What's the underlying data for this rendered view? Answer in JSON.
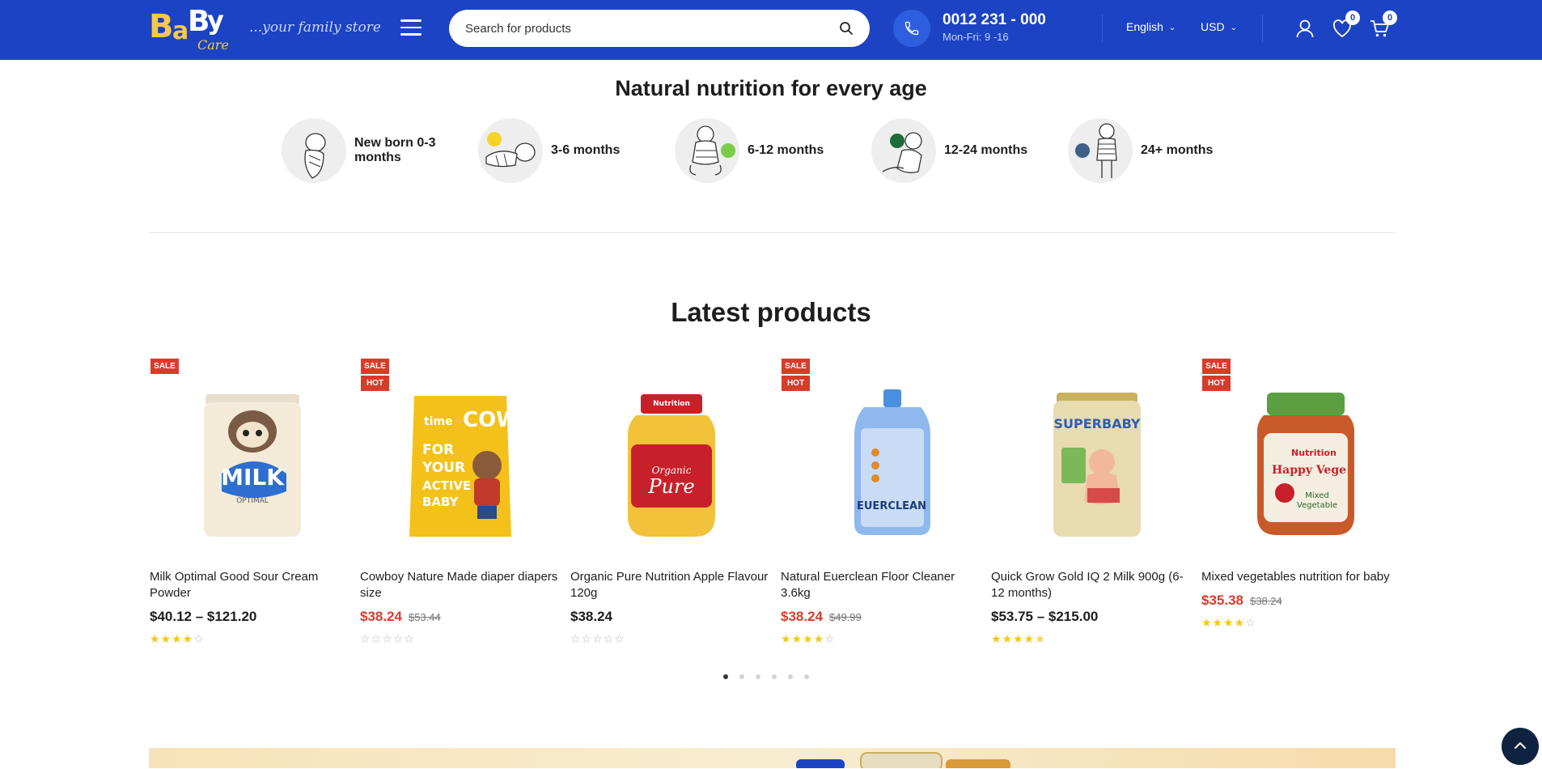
{
  "header": {
    "logo": "BaBy Care",
    "logo_sub": "Care",
    "tagline": "...your family store",
    "search_placeholder": "Search for products",
    "phone": "0012 231 - 000",
    "hours": "Mon-Fri: 9 -16",
    "language": "English",
    "currency": "USD",
    "wishlist_count": "0",
    "cart_count": "0"
  },
  "nutrition": {
    "title": "Natural nutrition for every age",
    "ages": [
      {
        "label": "New born 0-3 months"
      },
      {
        "label": "3-6 months"
      },
      {
        "label": "6-12 months"
      },
      {
        "label": "12-24 months"
      },
      {
        "label": "24+ months"
      }
    ]
  },
  "latest": {
    "title": "Latest products",
    "products": [
      {
        "name": "Milk Optimal Good Sour Cream Powder",
        "price": "$40.12 – $121.20",
        "old_price": "",
        "on_sale": true,
        "hot": false,
        "tags": [
          "SALE"
        ],
        "rating": 4,
        "rating_max": 5
      },
      {
        "name": "Cowboy Nature Made diaper diapers size",
        "price": "$38.24",
        "old_price": "$53.44",
        "on_sale": true,
        "hot": true,
        "tags": [
          "SALE",
          "HOT"
        ],
        "rating": 0,
        "rating_max": 5
      },
      {
        "name": "Organic Pure Nutrition Apple Flavour 120g",
        "price": "$38.24",
        "old_price": "",
        "on_sale": false,
        "hot": false,
        "tags": [],
        "rating": 0,
        "rating_max": 5
      },
      {
        "name": "Natural Euerclean Floor Cleaner 3.6kg",
        "price": "$38.24",
        "old_price": "$49.99",
        "on_sale": true,
        "hot": true,
        "tags": [
          "SALE",
          "HOT"
        ],
        "rating": 4,
        "rating_max": 5
      },
      {
        "name": "Quick Grow Gold IQ 2 Milk 900g (6-12 months)",
        "price": "$53.75 – $215.00",
        "old_price": "",
        "on_sale": false,
        "hot": false,
        "tags": [],
        "rating": 4.5,
        "rating_max": 5
      },
      {
        "name": "Mixed vegetables nutrition for baby",
        "price": "$35.38",
        "old_price": "$38.24",
        "on_sale": true,
        "hot": true,
        "tags": [
          "SALE",
          "HOT"
        ],
        "rating": 4,
        "rating_max": 5
      }
    ],
    "carousel_pages": 6,
    "carousel_active": 1
  },
  "colors": {
    "header_bg": "#1c43c4",
    "sale_red": "#d93b2b",
    "star_yellow": "#f5c518"
  }
}
